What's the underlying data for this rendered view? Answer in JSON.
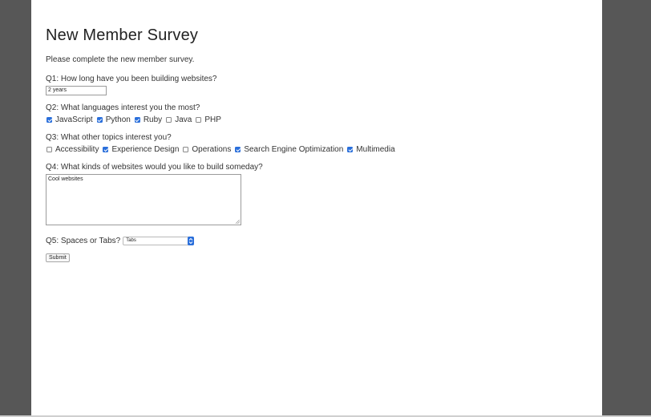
{
  "page": {
    "title": "New Member Survey",
    "intro": "Please complete the new member survey."
  },
  "q1": {
    "label": "Q1: How long have you been building websites?",
    "value": "2 years"
  },
  "q2": {
    "label": "Q2: What languages interest you the most?",
    "options": [
      {
        "label": "JavaScript",
        "checked": true
      },
      {
        "label": "Python",
        "checked": true
      },
      {
        "label": "Ruby",
        "checked": true
      },
      {
        "label": "Java",
        "checked": false
      },
      {
        "label": "PHP",
        "checked": false
      }
    ]
  },
  "q3": {
    "label": "Q3: What other topics interest you?",
    "options": [
      {
        "label": "Accessibility",
        "checked": false
      },
      {
        "label": "Experience Design",
        "checked": true
      },
      {
        "label": "Operations",
        "checked": false
      },
      {
        "label": "Search Engine Optimization",
        "checked": true
      },
      {
        "label": "Multimedia",
        "checked": true
      }
    ]
  },
  "q4": {
    "label": "Q4: What kinds of websites would you like to build someday?",
    "value": "Cool websites"
  },
  "q5": {
    "label": "Q5: Spaces or Tabs?",
    "selected": "Tabs"
  },
  "submit": {
    "label": "Submit"
  },
  "colors": {
    "accent": "#2a6fdb",
    "background": "#575757",
    "page": "#ffffff"
  }
}
